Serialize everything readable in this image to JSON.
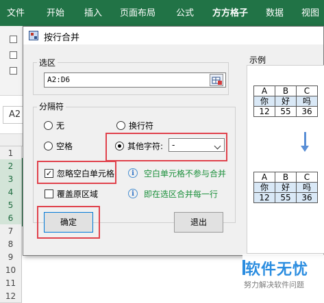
{
  "excel": {
    "ribbon_tabs": [
      "文件",
      "开始",
      "插入",
      "页面布局",
      "公式",
      "方方格子",
      "数据",
      "视图"
    ],
    "namebox": "A2",
    "row_headers": [
      "1",
      "2",
      "3",
      "4",
      "5",
      "6",
      "7",
      "8",
      "9",
      "10",
      "11",
      "12"
    ],
    "selected_rows": [
      "2",
      "3",
      "4",
      "5",
      "6"
    ]
  },
  "dialog": {
    "title": "按行合并",
    "selection": {
      "group_label": "选区",
      "value": "A2:D6"
    },
    "separator": {
      "group_label": "分隔符",
      "options": {
        "none": "无",
        "newline": "换行符",
        "space": "空格",
        "other": "其他字符:"
      },
      "selected": "other",
      "other_value": "-"
    },
    "options": {
      "ignore_blank": {
        "label": "忽略空白单元格",
        "checked": true
      },
      "overwrite": {
        "label": "覆盖原区域",
        "checked": false
      }
    },
    "info": {
      "blank_hint": "空白单元格不参与合并",
      "merge_hint": "即在选区合并每一行"
    },
    "buttons": {
      "ok": "确定",
      "exit": "退出"
    },
    "example": {
      "label": "示例",
      "top_table": [
        [
          "A",
          "B",
          "C"
        ],
        [
          "你",
          "好",
          "吗"
        ],
        [
          "12",
          "55",
          "36"
        ]
      ],
      "bottom_table": [
        [
          "A",
          "B",
          "C"
        ],
        [
          "你",
          "好",
          "吗"
        ],
        [
          "12",
          "55",
          "36"
        ]
      ]
    }
  },
  "watermark": {
    "main": "软件无忧",
    "sub": "努力解决软件问题"
  },
  "colors": {
    "excel_green": "#217346",
    "highlight_red": "#e0404a",
    "info_green": "#1a8f3a",
    "example_blue": "#d9e8f6",
    "arrow_blue": "#5a8fd6"
  }
}
